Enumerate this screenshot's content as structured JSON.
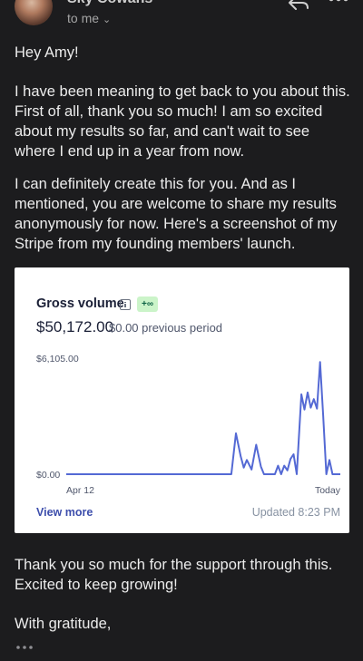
{
  "email": {
    "sender": "Sky Cowans",
    "to": "to me",
    "greeting": "Hey Amy!",
    "paragraph1": "I have been meaning to get back to you about this. First of all, thank you so much! I am so excited about my results so far, and can't wait to see where I end up in a year from now.",
    "paragraph2": "I can definitely create this for you. And as I mentioned, you are welcome to share my results anonymously for now. Here's a screenshot of my Stripe from my founding members' launch.",
    "paragraph3": "Thank you so much for the support through this. Excited to keep growing!",
    "closing": "With gratitude,"
  },
  "icons": {
    "reply": "reply-icon",
    "more": "more-horizontal-icon",
    "chevron": "chevron-down-icon",
    "info": "info-icon",
    "trimmed": "ellipsis-icon"
  },
  "stripe": {
    "title": "Gross volume",
    "badge": "+∞",
    "amount": "$50,172.00",
    "previous": "$0.00 previous period",
    "view_more": "View more",
    "updated": "Updated 8:23 PM"
  },
  "chart_data": {
    "type": "line",
    "title": "Gross volume",
    "y_tick_labels": [
      "$6,105.00",
      "$0.00"
    ],
    "x_tick_labels": [
      "Apr 12",
      "Today"
    ],
    "ylim": [
      0,
      6105
    ],
    "grid": false,
    "color": "#5469d4",
    "series": [
      {
        "x": [
          0,
          1,
          2,
          3,
          4,
          5,
          6,
          7,
          8,
          9,
          10,
          11,
          12,
          13,
          14,
          15,
          16,
          17,
          18,
          19,
          20,
          21,
          22,
          23,
          24,
          25,
          26,
          27,
          28,
          29,
          30,
          31,
          32,
          33,
          34,
          35,
          36,
          37,
          38,
          39,
          40,
          41,
          42,
          43,
          44,
          45,
          46,
          47,
          48,
          49,
          50,
          51,
          52,
          53,
          54,
          55,
          56,
          57,
          58,
          59,
          60,
          61,
          62,
          63,
          64,
          65,
          66,
          67,
          68,
          69,
          70,
          71,
          72,
          73,
          74,
          75,
          76,
          77,
          78,
          79,
          80,
          81,
          82,
          83,
          84,
          85,
          86,
          87,
          88,
          89,
          90,
          91,
          92,
          93,
          94,
          95,
          96,
          97,
          98,
          99
        ],
        "y": [
          0,
          0,
          0,
          0,
          0,
          0,
          0,
          0,
          0,
          0,
          0,
          0,
          0,
          0,
          0,
          0,
          0,
          0,
          0,
          0,
          0,
          0,
          0,
          0,
          0,
          0,
          0,
          0,
          0,
          0,
          0,
          0,
          0,
          0,
          0,
          0,
          0,
          0,
          0,
          0,
          0,
          0,
          0,
          0,
          0,
          0,
          0,
          0,
          0,
          0,
          0,
          0,
          0,
          0,
          0,
          0,
          0,
          0,
          0,
          0,
          0,
          0,
          0,
          0,
          0,
          0,
          0,
          0,
          0,
          0,
          0,
          0,
          0,
          0,
          0,
          0,
          0,
          0,
          0,
          0,
          0,
          0,
          0,
          0,
          0,
          0,
          0,
          0,
          0,
          0,
          0,
          0,
          0,
          0,
          0,
          0,
          0,
          0,
          0,
          0
        ]
      }
    ],
    "points": [
      [
        0,
        0
      ],
      [
        53,
        0
      ],
      [
        54.5,
        2150
      ],
      [
        56,
        950
      ],
      [
        57,
        350
      ],
      [
        58,
        750
      ],
      [
        59.5,
        250
      ],
      [
        61,
        1550
      ],
      [
        62.5,
        400
      ],
      [
        63.5,
        0
      ],
      [
        67,
        0
      ],
      [
        68,
        450
      ],
      [
        69,
        0
      ],
      [
        70,
        450
      ],
      [
        71,
        200
      ],
      [
        72,
        800
      ],
      [
        73,
        1050
      ],
      [
        74,
        0
      ],
      [
        75.5,
        4200
      ],
      [
        76.5,
        3400
      ],
      [
        77.5,
        4300
      ],
      [
        78.5,
        3500
      ],
      [
        79.5,
        3950
      ],
      [
        80.5,
        3450
      ],
      [
        81.5,
        5900
      ],
      [
        82.5,
        3100
      ],
      [
        83.5,
        0
      ],
      [
        84.5,
        750
      ],
      [
        85.5,
        0
      ],
      [
        88,
        0
      ]
    ]
  }
}
